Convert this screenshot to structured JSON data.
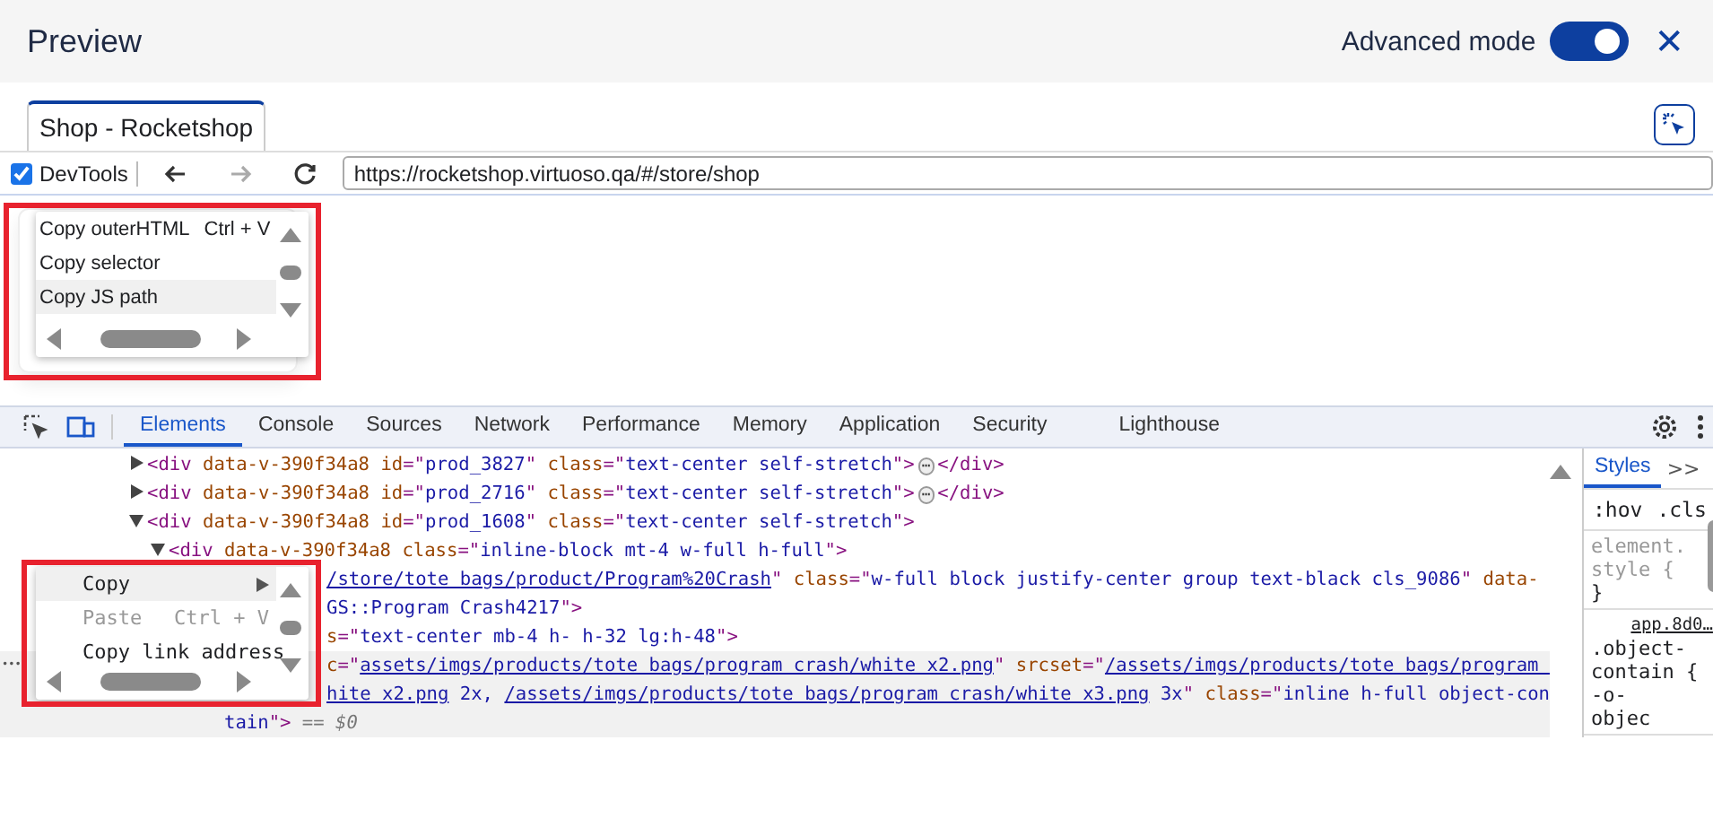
{
  "header": {
    "title": "Preview",
    "advanced_mode": {
      "label": "Advanced mode",
      "on": true
    },
    "close": "✕"
  },
  "browser": {
    "tabs": [
      {
        "label": "Shop - Rocketshop",
        "selected": true
      }
    ],
    "devtools_checkbox": {
      "label": "DevTools",
      "checked": true
    },
    "nav": [
      {
        "kind": "back",
        "disabled": false
      },
      {
        "kind": "forward",
        "disabled": true
      },
      {
        "kind": "reload",
        "disabled": false
      }
    ],
    "url": "https://rocketshop.virtuoso.qa/#/store/shop"
  },
  "page_menu": {
    "items": [
      {
        "label": "Copy outerHTML",
        "shortcut": "Ctrl + V",
        "submenu": false,
        "selected": false,
        "disabled": false
      },
      {
        "label": "Copy selector",
        "submenu": false,
        "selected": false,
        "disabled": false
      },
      {
        "label": "Copy JS path",
        "submenu": false,
        "selected": true,
        "disabled": false
      }
    ]
  },
  "devtools": {
    "tabs": [
      {
        "label": "Elements",
        "selected": true
      },
      {
        "label": "Console",
        "selected": false
      },
      {
        "label": "Sources",
        "selected": false
      },
      {
        "label": "Network",
        "selected": false
      },
      {
        "label": "Performance",
        "selected": false
      },
      {
        "label": "Memory",
        "selected": false
      },
      {
        "label": "Application",
        "selected": false
      },
      {
        "label": "Security",
        "selected": false
      },
      {
        "label": "Lighthouse",
        "selected": false
      }
    ],
    "lines": [
      {
        "expanded": false,
        "highlighted": false,
        "tokens": [
          {
            "t": "<div ",
            "kind": "tag"
          },
          {
            "t": "data-v-390f34a8 ",
            "kind": "attr"
          },
          {
            "t": "id",
            "kind": "attr"
          },
          {
            "t": "=\"",
            "kind": "tag"
          },
          {
            "t": "prod_3827",
            "kind": "value"
          },
          {
            "t": "\" ",
            "kind": "tag"
          },
          {
            "t": "class",
            "kind": "attr"
          },
          {
            "t": "=\"",
            "kind": "tag"
          },
          {
            "t": "text-center self-stretch",
            "kind": "value"
          },
          {
            "t": "\">",
            "kind": "tag"
          },
          {
            "t": "⋯",
            "kind": "pill"
          },
          {
            "t": "</div>",
            "kind": "tag"
          }
        ]
      },
      {
        "expanded": false,
        "highlighted": false,
        "tokens": [
          {
            "t": "<div ",
            "kind": "tag"
          },
          {
            "t": "data-v-390f34a8 ",
            "kind": "attr"
          },
          {
            "t": "id",
            "kind": "attr"
          },
          {
            "t": "=\"",
            "kind": "tag"
          },
          {
            "t": "prod_2716",
            "kind": "value"
          },
          {
            "t": "\" ",
            "kind": "tag"
          },
          {
            "t": "class",
            "kind": "attr"
          },
          {
            "t": "=\"",
            "kind": "tag"
          },
          {
            "t": "text-center self-stretch",
            "kind": "value"
          },
          {
            "t": "\">",
            "kind": "tag"
          },
          {
            "t": "⋯",
            "kind": "pill"
          },
          {
            "t": "</div>",
            "kind": "tag"
          }
        ]
      },
      {
        "expanded": true,
        "highlighted": false,
        "tokens": [
          {
            "t": "<div ",
            "kind": "tag"
          },
          {
            "t": "data-v-390f34a8 ",
            "kind": "attr"
          },
          {
            "t": "id",
            "kind": "attr"
          },
          {
            "t": "=\"",
            "kind": "tag"
          },
          {
            "t": "prod_1608",
            "kind": "value"
          },
          {
            "t": "\" ",
            "kind": "tag"
          },
          {
            "t": "class",
            "kind": "attr"
          },
          {
            "t": "=\"",
            "kind": "tag"
          },
          {
            "t": "text-center self-stretch",
            "kind": "value"
          },
          {
            "t": "\">",
            "kind": "tag"
          }
        ]
      },
      {
        "expanded": true,
        "highlighted": false,
        "tokens": [
          {
            "t": "<div ",
            "kind": "tag"
          },
          {
            "t": "data-v-390f34a8 ",
            "kind": "attr"
          },
          {
            "t": "class",
            "kind": "attr"
          },
          {
            "t": "=\"",
            "kind": "tag"
          },
          {
            "t": "inline-block mt-4 w-full h-full",
            "kind": "value"
          },
          {
            "t": "\">",
            "kind": "tag"
          }
        ]
      },
      {
        "highlighted": false,
        "tokens": [
          {
            "t": "/store/tote bags/product/Program%20Crash",
            "kind": "link"
          },
          {
            "t": "\" ",
            "kind": "tag"
          },
          {
            "t": "class",
            "kind": "attr"
          },
          {
            "t": "=\"",
            "kind": "tag"
          },
          {
            "t": "w-full block justify-center group text-black cls_9086",
            "kind": "value"
          },
          {
            "t": "\" ",
            "kind": "tag"
          },
          {
            "t": "data-",
            "kind": "attr"
          }
        ]
      },
      {
        "highlighted": false,
        "tokens": [
          {
            "t": "GS::Program Crash4217",
            "kind": "value"
          },
          {
            "t": "\">",
            "kind": "tag"
          }
        ]
      },
      {
        "highlighted": false,
        "tokens": [
          {
            "t": "s",
            "kind": "attr"
          },
          {
            "t": "=\"",
            "kind": "tag"
          },
          {
            "t": "text-center mb-4 h- h-32 lg:h-48",
            "kind": "value"
          },
          {
            "t": "\">",
            "kind": "tag"
          }
        ]
      },
      {
        "highlighted": true,
        "gutter": "•••",
        "tokens": [
          {
            "t": "c",
            "kind": "attr"
          },
          {
            "t": "=\"",
            "kind": "tag"
          },
          {
            "t": "assets/imgs/products/tote bags/program crash/white x2.png",
            "kind": "link"
          },
          {
            "t": "\" ",
            "kind": "tag"
          },
          {
            "t": "srcset",
            "kind": "attr"
          },
          {
            "t": "=\"",
            "kind": "tag"
          },
          {
            "t": "/assets/imgs/products/tote bags/program ",
            "kind": "link"
          }
        ]
      },
      {
        "highlighted": true,
        "tokens": [
          {
            "t": "hite x2.png",
            "kind": "link"
          },
          {
            "t": " 2x, ",
            "kind": "value"
          },
          {
            "t": "/assets/imgs/products/tote bags/program crash/white x3.png",
            "kind": "link"
          },
          {
            "t": " 3x",
            "kind": "value"
          },
          {
            "t": "\" ",
            "kind": "tag"
          },
          {
            "t": "class",
            "kind": "attr"
          },
          {
            "t": "=\"",
            "kind": "tag"
          },
          {
            "t": "inline h-full object-con",
            "kind": "value"
          }
        ]
      },
      {
        "highlighted": true,
        "tokens": [
          {
            "t": "tain",
            "kind": "value"
          },
          {
            "t": "\">",
            "kind": "tag"
          },
          {
            "t": " == $0",
            "kind": "dim"
          }
        ]
      }
    ],
    "context_menu": {
      "items": [
        {
          "label": "Copy",
          "submenu": true,
          "selected": true,
          "disabled": false
        },
        {
          "label": "Paste",
          "shortcut": "Ctrl + V",
          "submenu": false,
          "selected": false,
          "disabled": true
        },
        {
          "label": "Copy link address",
          "submenu": false,
          "selected": false,
          "disabled": false
        }
      ]
    },
    "styles_pane": {
      "tabs": [
        {
          "label": "Styles",
          "selected": true
        }
      ],
      "more": ">>",
      "filters": [
        ":hov",
        ".cls"
      ],
      "rules": [
        {
          "lines": [
            "element.",
            "style {",
            "}"
          ]
        },
        {
          "source": "app.8d0…",
          "lines": [
            ".object-",
            "contain {",
            "-o-",
            "objec"
          ]
        }
      ]
    }
  }
}
